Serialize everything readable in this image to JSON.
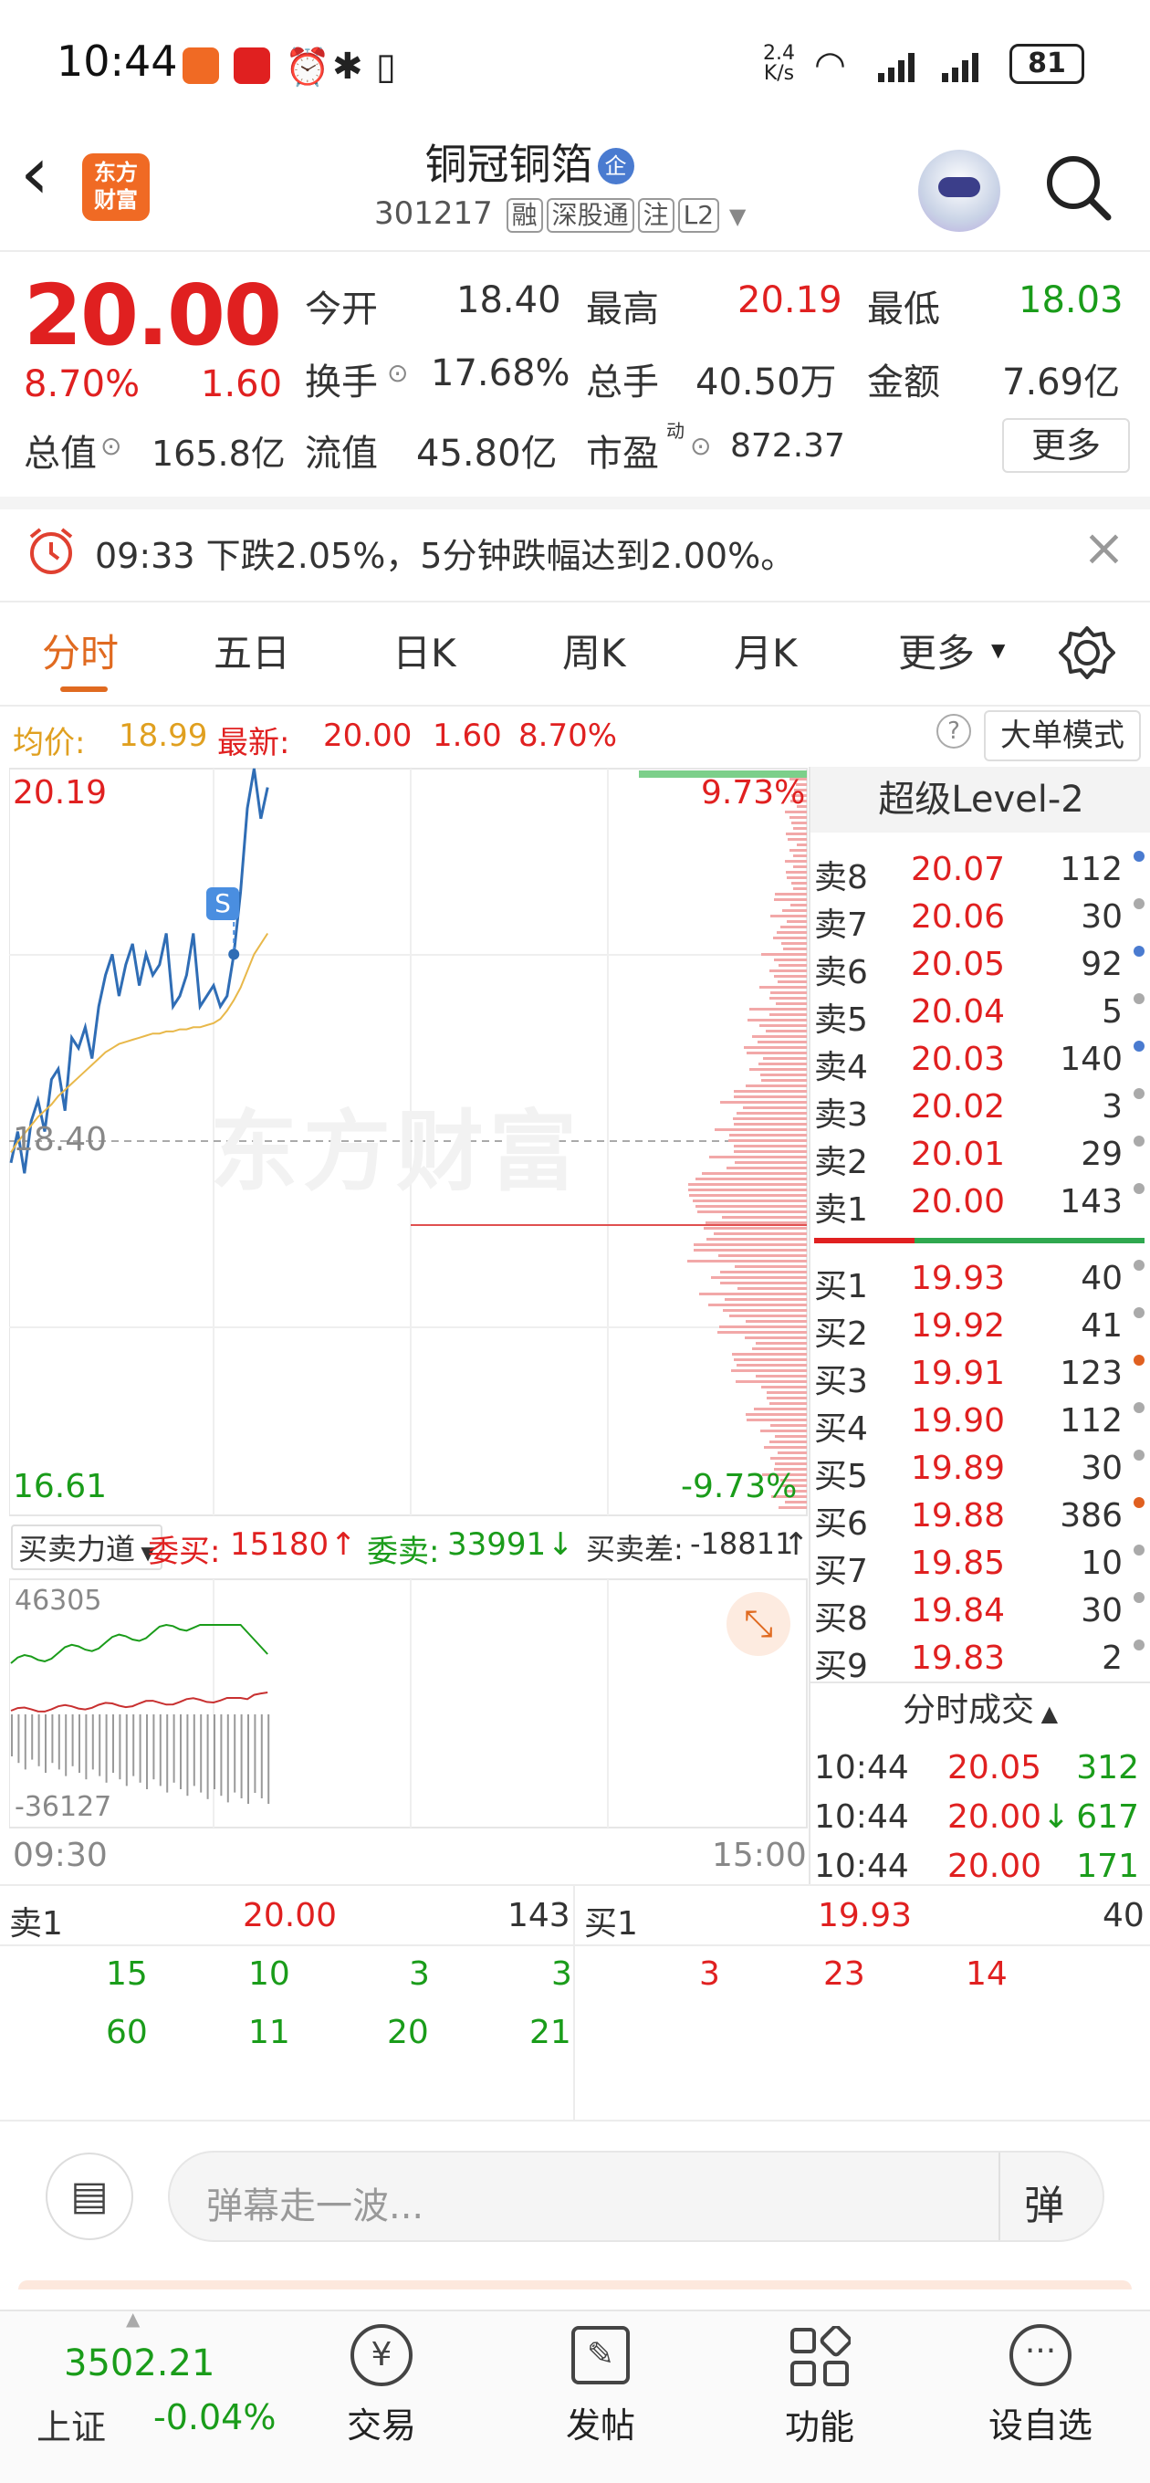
{
  "status_bar": {
    "time": "10:44",
    "net_speed": "2.4\nK/s",
    "battery": "81"
  },
  "header": {
    "back": "‹",
    "logo_text": "东方\n财富",
    "title": "铜冠铜箔",
    "title_badge": "企",
    "code": "301217",
    "tags": [
      "融",
      "深股通",
      "注",
      "L2"
    ]
  },
  "quote": {
    "price": "20.00",
    "change_pct": "8.70%",
    "change": "1.60",
    "open_label": "今开",
    "open": "18.40",
    "high_label": "最高",
    "high": "20.19",
    "low_label": "最低",
    "low": "18.03",
    "turnover_label": "换手",
    "turnover": "17.68%",
    "volume_label": "总手",
    "volume": "40.50万",
    "amount_label": "金额",
    "amount": "7.69亿",
    "mktcap_label": "总值",
    "mktcap": "165.8亿",
    "float_label": "流值",
    "float_cap": "45.80亿",
    "pe_label": "市盈",
    "pe_sup": "动",
    "pe": "872.37",
    "more_button": "更多"
  },
  "alert": {
    "text": "09:33 下跌2.05%，5分钟跌幅达到2.00%。"
  },
  "tabs": [
    "分时",
    "五日",
    "日K",
    "周K",
    "月K",
    "更多"
  ],
  "chart_header": {
    "avg_label": "均价:",
    "avg": "18.99",
    "latest_label": "最新:",
    "latest": "20.00",
    "change": "1.60",
    "pct": "8.70%",
    "mode_button": "大单模式"
  },
  "chart_labels": {
    "y_top": "20.19",
    "y_mid": "18.40",
    "y_bottom": "16.61",
    "pct_top": "9.73%",
    "pct_bottom": "-9.73%",
    "watermark": "东方财富",
    "signal": "S",
    "time_start": "09:30",
    "time_end": "15:00"
  },
  "chart_data": {
    "type": "line",
    "title": "",
    "xlabel": "",
    "ylabel": "",
    "ylim": [
      16.61,
      20.19
    ],
    "x_range": [
      "09:30",
      "15:00"
    ],
    "series": [
      {
        "name": "最新",
        "color": "#2f6db5",
        "values": [
          18.3,
          18.45,
          18.25,
          18.5,
          18.6,
          18.45,
          18.7,
          18.75,
          18.55,
          18.9,
          18.85,
          18.95,
          18.8,
          19.05,
          19.2,
          19.3,
          19.1,
          19.25,
          19.35,
          19.15,
          19.3,
          19.2,
          19.25,
          19.4,
          19.05,
          19.1,
          19.2,
          19.4,
          19.05,
          19.1,
          19.15,
          19.05,
          19.1,
          19.3,
          19.6,
          20.0,
          20.19,
          19.95,
          20.1
        ]
      },
      {
        "name": "均价",
        "color": "#e8b84a",
        "values": [
          18.35,
          18.4,
          18.44,
          18.48,
          18.52,
          18.55,
          18.58,
          18.62,
          18.65,
          18.68,
          18.71,
          18.74,
          18.77,
          18.8,
          18.83,
          18.85,
          18.87,
          18.88,
          18.89,
          18.9,
          18.91,
          18.92,
          18.92,
          18.93,
          18.93,
          18.94,
          18.94,
          18.95,
          18.95,
          18.96,
          18.97,
          18.99,
          19.03,
          19.08,
          19.14,
          19.22,
          19.3,
          19.35,
          19.4
        ]
      }
    ]
  },
  "sub_chart": {
    "name": "买卖力道",
    "buy_label": "委买:",
    "buy": "15180",
    "sell_label": "委卖:",
    "sell": "33991",
    "diff_label": "买卖差:",
    "diff": "-18811",
    "y_top": "46305",
    "y_bottom": "-36127"
  },
  "order_book": {
    "title": "超级Level-2",
    "asks": [
      {
        "label": "卖8",
        "price": "20.07",
        "vol": "112",
        "dot": "#4a7bd0"
      },
      {
        "label": "卖7",
        "price": "20.06",
        "vol": "30",
        "dot": "#aaaaaa"
      },
      {
        "label": "卖6",
        "price": "20.05",
        "vol": "92",
        "dot": "#4a7bd0"
      },
      {
        "label": "卖5",
        "price": "20.04",
        "vol": "5",
        "dot": "#aaaaaa"
      },
      {
        "label": "卖4",
        "price": "20.03",
        "vol": "140",
        "dot": "#4a7bd0"
      },
      {
        "label": "卖3",
        "price": "20.02",
        "vol": "3",
        "dot": "#aaaaaa"
      },
      {
        "label": "卖2",
        "price": "20.01",
        "vol": "29",
        "dot": "#aaaaaa"
      },
      {
        "label": "卖1",
        "price": "20.00",
        "vol": "143",
        "dot": "#aaaaaa"
      }
    ],
    "bids": [
      {
        "label": "买1",
        "price": "19.93",
        "vol": "40",
        "dot": "#aaaaaa"
      },
      {
        "label": "买2",
        "price": "19.92",
        "vol": "41",
        "dot": "#aaaaaa"
      },
      {
        "label": "买3",
        "price": "19.91",
        "vol": "123",
        "dot": "#e06020"
      },
      {
        "label": "买4",
        "price": "19.90",
        "vol": "112",
        "dot": "#aaaaaa"
      },
      {
        "label": "买5",
        "price": "19.89",
        "vol": "30",
        "dot": "#aaaaaa"
      },
      {
        "label": "买6",
        "price": "19.88",
        "vol": "386",
        "dot": "#e06020"
      },
      {
        "label": "买7",
        "price": "19.85",
        "vol": "10",
        "dot": "#aaaaaa"
      },
      {
        "label": "买8",
        "price": "19.84",
        "vol": "30",
        "dot": "#aaaaaa"
      },
      {
        "label": "买9",
        "price": "19.83",
        "vol": "2",
        "dot": "#aaaaaa"
      }
    ],
    "trades_title": "分时成交",
    "trades": [
      {
        "time": "10:44",
        "price": "20.05",
        "arrow": "",
        "vol": "312",
        "color": "#1a9c1a"
      },
      {
        "time": "10:44",
        "price": "20.00",
        "arrow": "↓",
        "vol": "617",
        "color": "#1a9c1a"
      },
      {
        "time": "10:44",
        "price": "20.00",
        "arrow": "",
        "vol": "171",
        "color": "#1a9c1a"
      }
    ]
  },
  "queues": {
    "sell": {
      "label": "卖1",
      "price": "20.00",
      "vol": "143",
      "row1": [
        "15",
        "10",
        "3",
        "3"
      ],
      "row2": [
        "60",
        "11",
        "20",
        "21"
      ]
    },
    "buy": {
      "label": "买1",
      "price": "19.93",
      "vol": "40",
      "row1": [
        "3",
        "23",
        "14"
      ]
    }
  },
  "comment": {
    "placeholder": "弹幕走一波...",
    "danmu_button": "弹"
  },
  "bottom_nav": {
    "index_value": "3502.21",
    "index_name": "上证",
    "index_change": "-0.04%",
    "items": [
      "交易",
      "发帖",
      "功能",
      "设自选"
    ]
  }
}
